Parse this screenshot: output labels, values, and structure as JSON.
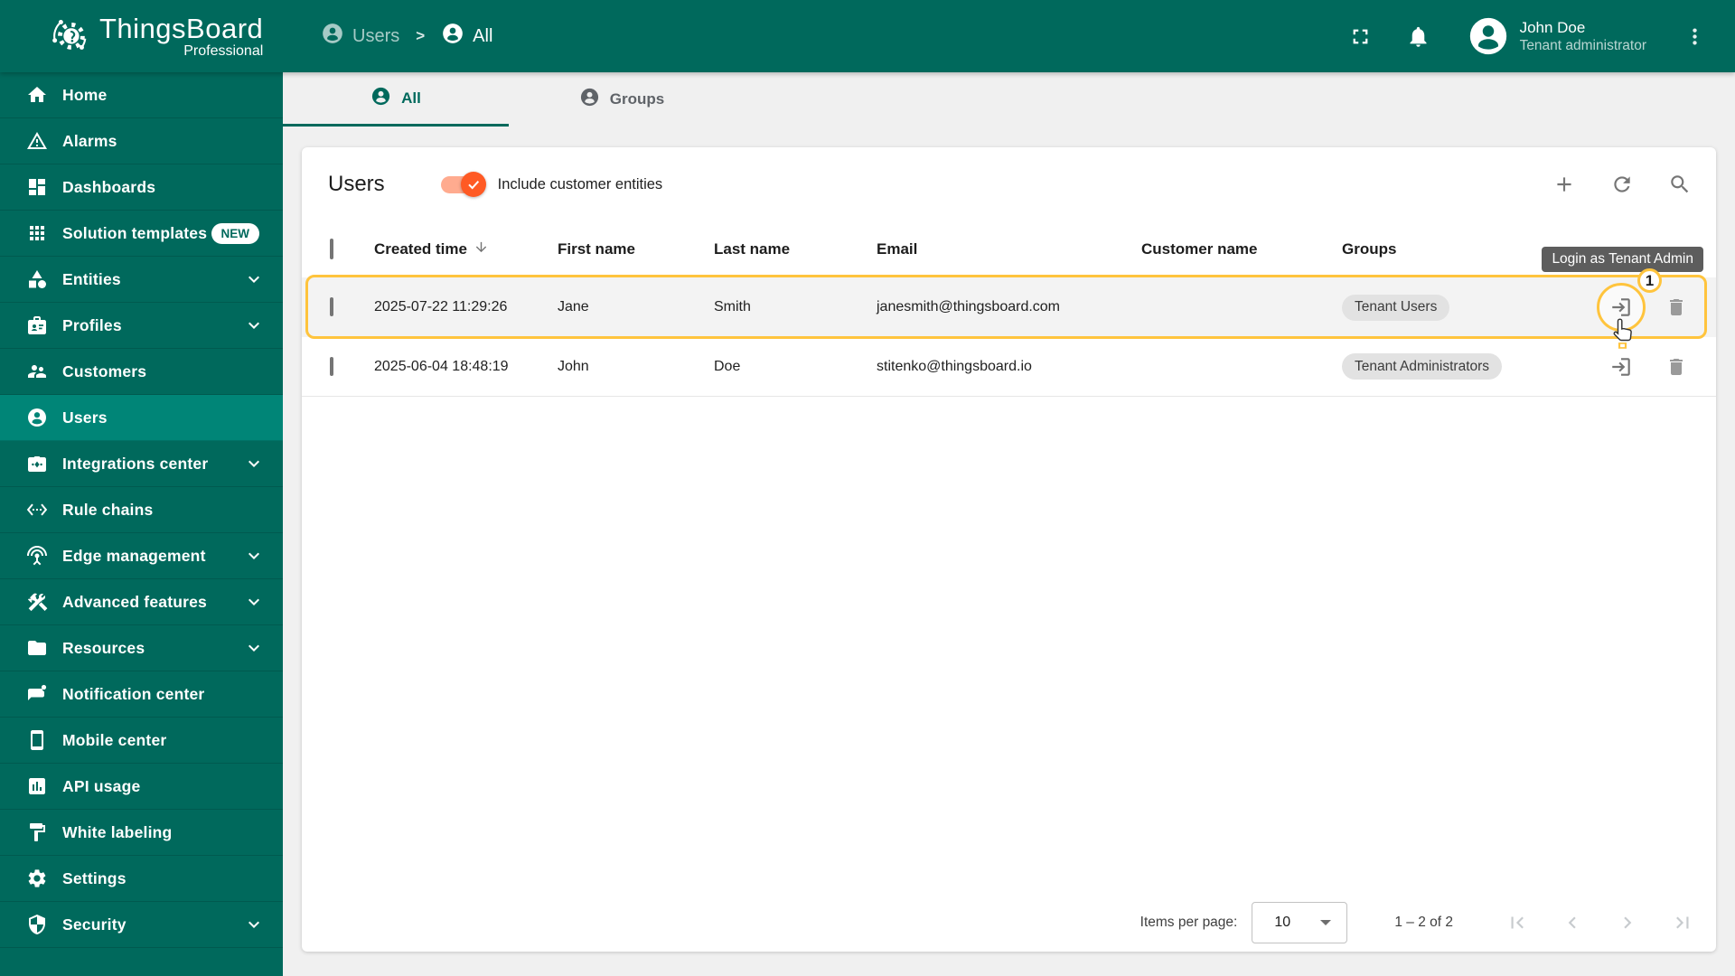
{
  "header": {
    "logo": {
      "title": "ThingsBoard",
      "subtitle": "Professional"
    },
    "breadcrumb": {
      "users": "Users",
      "separator": ">",
      "all": "All"
    },
    "user": {
      "name": "John Doe",
      "role": "Tenant administrator"
    }
  },
  "sidebar": {
    "items": [
      {
        "label": "Home"
      },
      {
        "label": "Alarms"
      },
      {
        "label": "Dashboards"
      },
      {
        "label": "Solution templates",
        "badge": "NEW"
      },
      {
        "label": "Entities"
      },
      {
        "label": "Profiles"
      },
      {
        "label": "Customers"
      },
      {
        "label": "Users"
      },
      {
        "label": "Integrations center"
      },
      {
        "label": "Rule chains"
      },
      {
        "label": "Edge management"
      },
      {
        "label": "Advanced features"
      },
      {
        "label": "Resources"
      },
      {
        "label": "Notification center"
      },
      {
        "label": "Mobile center"
      },
      {
        "label": "API usage"
      },
      {
        "label": "White labeling"
      },
      {
        "label": "Settings"
      },
      {
        "label": "Security"
      }
    ]
  },
  "tabs": [
    {
      "label": "All"
    },
    {
      "label": "Groups"
    }
  ],
  "main": {
    "title": "Users",
    "toggle_label": "Include customer entities",
    "toggle_on": true,
    "table": {
      "columns": [
        "Created time",
        "First name",
        "Last name",
        "Email",
        "Customer name",
        "Groups"
      ],
      "sorted_column": "Created time",
      "sort_direction": "desc",
      "rows": [
        {
          "created": "2025-07-22 11:29:26",
          "first": "Jane",
          "last": "Smith",
          "email": "janesmith@thingsboard.com",
          "customer": "",
          "group": "Tenant Users",
          "highlighted": true
        },
        {
          "created": "2025-06-04 18:48:19",
          "first": "John",
          "last": "Doe",
          "email": "stitenko@thingsboard.io",
          "customer": "",
          "group": "Tenant Administrators",
          "highlighted": false
        }
      ]
    },
    "tooltip": "Login as Tenant Admin",
    "step_badge": "1",
    "pagination": {
      "label": "Items per page:",
      "per_page": "10",
      "range": "1 – 2 of 2"
    }
  },
  "colors": {
    "primary": "#00695c",
    "primary_active": "#008577",
    "accent_orange": "#ff5a24",
    "highlight_yellow": "#ffc43d",
    "tooltip_bg": "#5d5d5d",
    "page_bg": "#f0f0f0"
  }
}
